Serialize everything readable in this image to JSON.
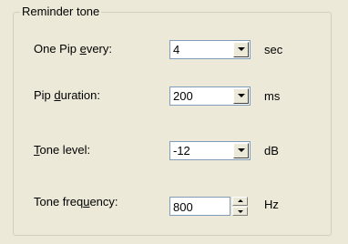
{
  "group": {
    "title": "Reminder tone"
  },
  "rows": [
    {
      "label_pre": "One Pip ",
      "label_accel": "e",
      "label_post": "very:",
      "value": "4",
      "unit": "sec"
    },
    {
      "label_pre": "Pip ",
      "label_accel": "d",
      "label_post": "uration:",
      "value": "200",
      "unit": "ms"
    },
    {
      "label_pre": "",
      "label_accel": "T",
      "label_post": "one level:",
      "value": "-12",
      "unit": "dB"
    },
    {
      "label_pre": "Tone freq",
      "label_accel": "u",
      "label_post": "ency:",
      "value": "800",
      "unit": "Hz"
    }
  ],
  "icons": {
    "dropdown": "chevron-down-icon",
    "spin_up": "spin-up-icon",
    "spin_down": "spin-down-icon"
  },
  "colors": {
    "background": "#ece9d8",
    "field_border": "#7f9db9",
    "groupbox_border": "#d0d0bf"
  }
}
